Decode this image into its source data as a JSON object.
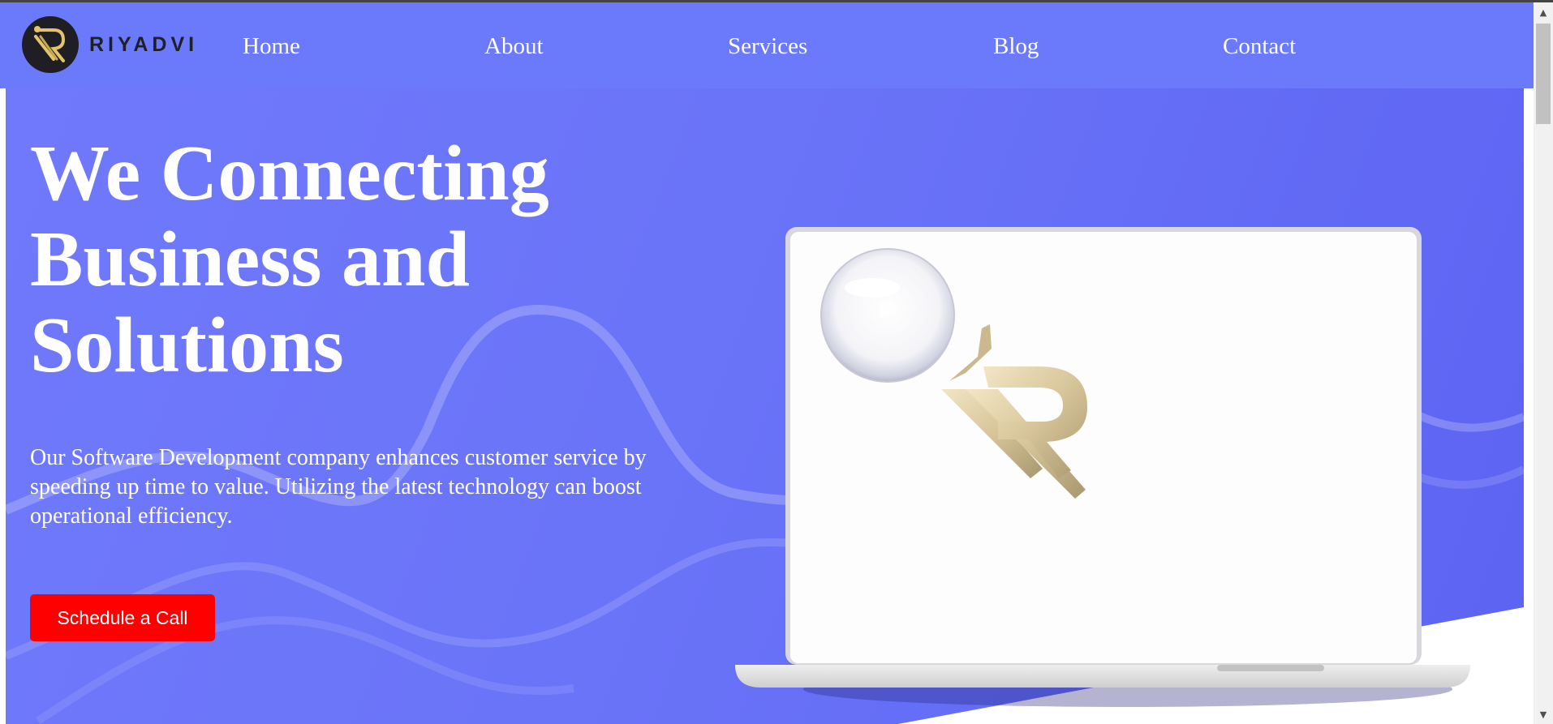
{
  "brand": {
    "name": "RIYADVI",
    "icon": "riyadvi-logo"
  },
  "nav": {
    "links": [
      {
        "label": "Home"
      },
      {
        "label": "About"
      },
      {
        "label": "Services"
      },
      {
        "label": "Blog"
      },
      {
        "label": "Contact"
      }
    ]
  },
  "hero": {
    "headline_line1": "We Connecting",
    "headline_line2": "Business and",
    "headline_line3": "Solutions",
    "description": "Our Software Development company enhances customer service by speeding up time to value. Utilizing the latest technology can boost operational efficiency.",
    "cta_label": "Schedule a Call",
    "illustration": "laptop-with-riyadvi-logo"
  },
  "colors": {
    "nav_bg": "#6b79fb",
    "hero_bg": "#6a74f8",
    "cta_bg": "#ff0000",
    "text": "#ffffff"
  },
  "scrollbar": {
    "up_icon": "scroll-up-arrow",
    "down_icon": "scroll-down-arrow"
  }
}
